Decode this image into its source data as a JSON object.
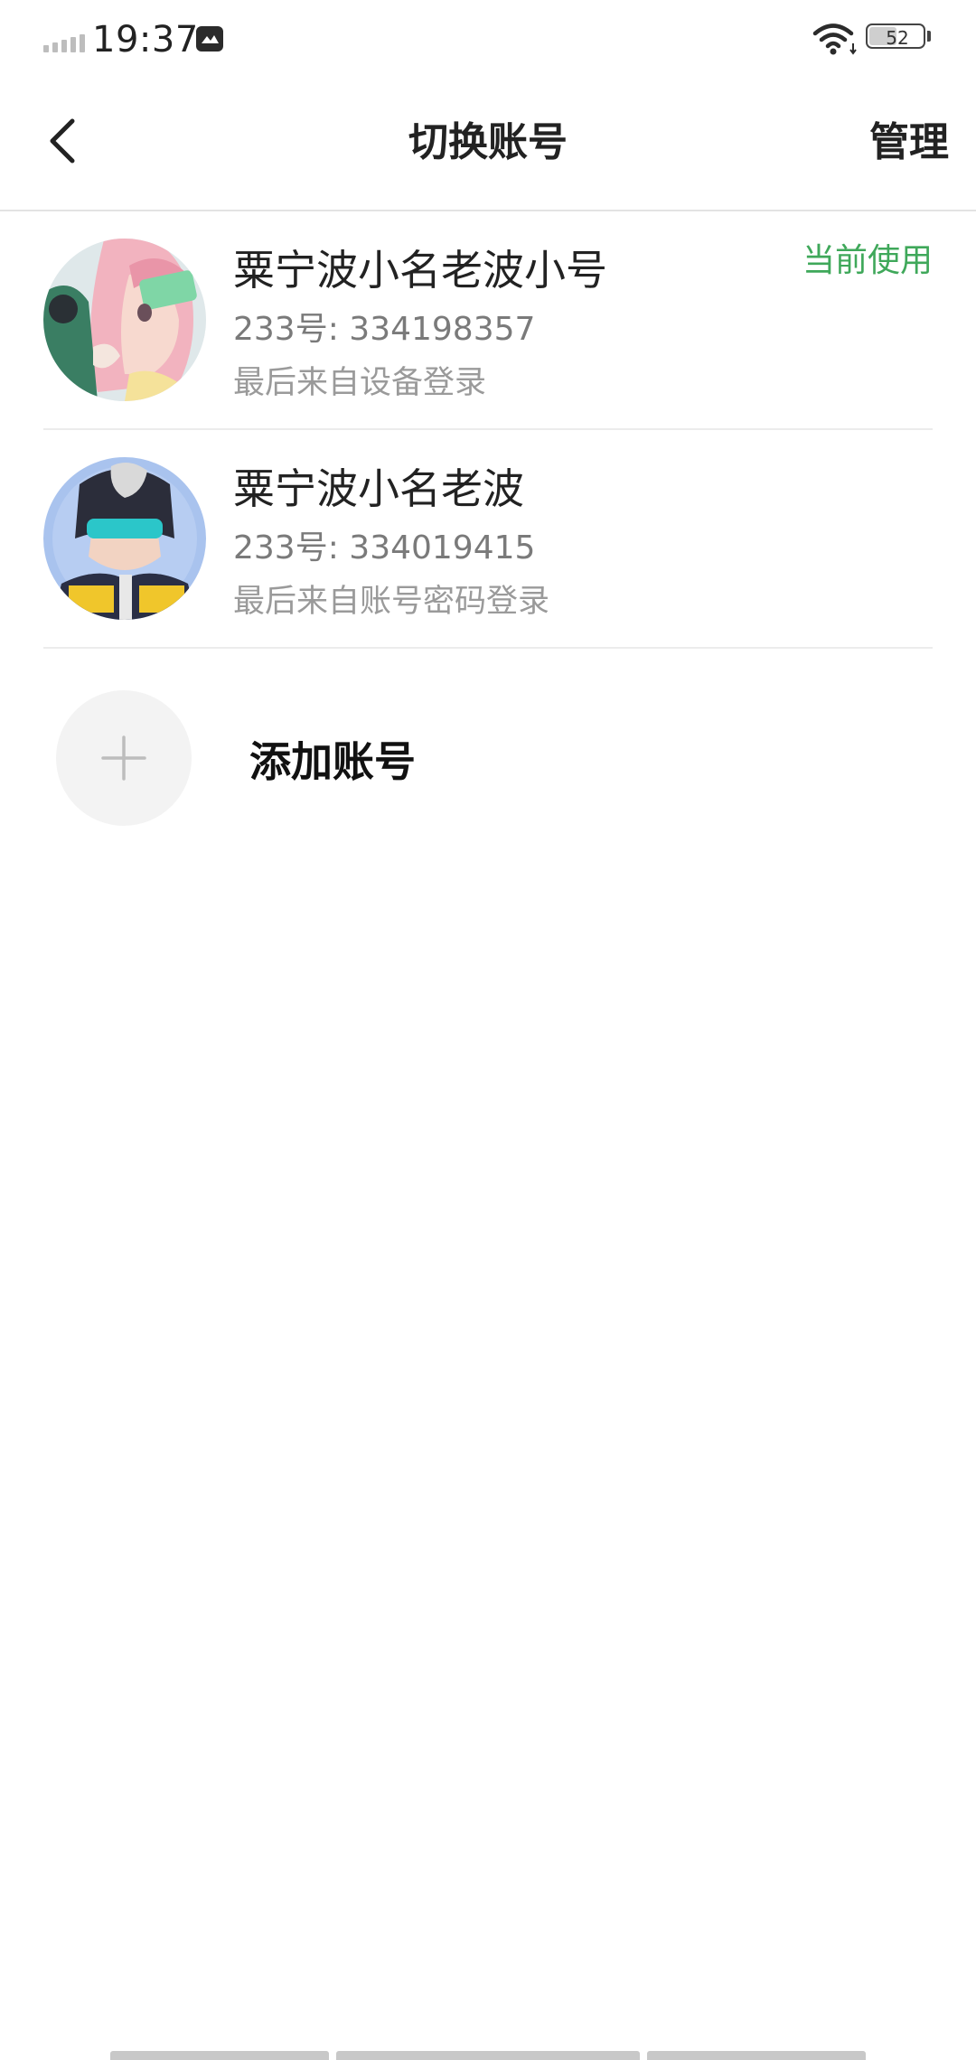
{
  "status_bar": {
    "time": "19:37",
    "battery_level": "52",
    "battery_fraction": 0.52,
    "icons": [
      "signal-icon",
      "message-icon",
      "wifi-icon",
      "battery-icon"
    ]
  },
  "header": {
    "title": "切换账号",
    "manage_label": "管理",
    "back_icon": "chevron-left-icon"
  },
  "accounts": [
    {
      "name": "粟宁波小名老波小号",
      "id_line": "233号: 334198357",
      "login_line": "最后来自设备登录",
      "badge": "当前使用",
      "avatar": "anime-avatar-pink"
    },
    {
      "name": "粟宁波小名老波",
      "id_line": "233号: 334019415",
      "login_line": "最后来自账号密码登录",
      "badge": "",
      "avatar": "anime-avatar-blue"
    }
  ],
  "add_account": {
    "label": "添加账号",
    "icon": "plus-icon"
  },
  "colors": {
    "accent_green": "#3fa85a",
    "divider": "#ececec",
    "text_primary": "#222222",
    "text_secondary": "#7a7a7a",
    "text_tertiary": "#9a9a9a"
  }
}
